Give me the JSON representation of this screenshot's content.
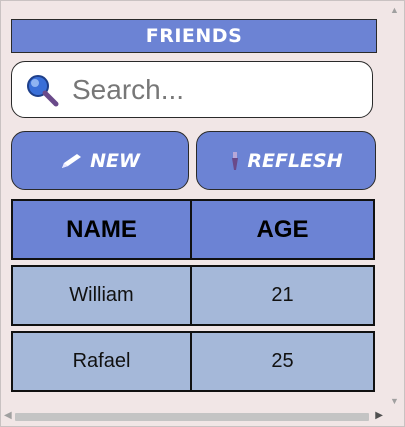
{
  "header": {
    "title": "FRIENDS"
  },
  "search": {
    "placeholder": "Search...",
    "value": ""
  },
  "toolbar": {
    "new_label": "NEW",
    "refresh_label": "REFLESH"
  },
  "table": {
    "columns": [
      "NAME",
      "AGE"
    ],
    "rows": [
      [
        "William",
        "21"
      ],
      [
        "Rafael",
        "25"
      ]
    ]
  },
  "colors": {
    "accent": "#6c83d4",
    "row_bg": "#a5b8d9",
    "page_bg": "#f1e6e6"
  },
  "icons": {
    "search": "magnifier-icon",
    "new": "pencil-icon",
    "refresh": "brush-icon"
  }
}
